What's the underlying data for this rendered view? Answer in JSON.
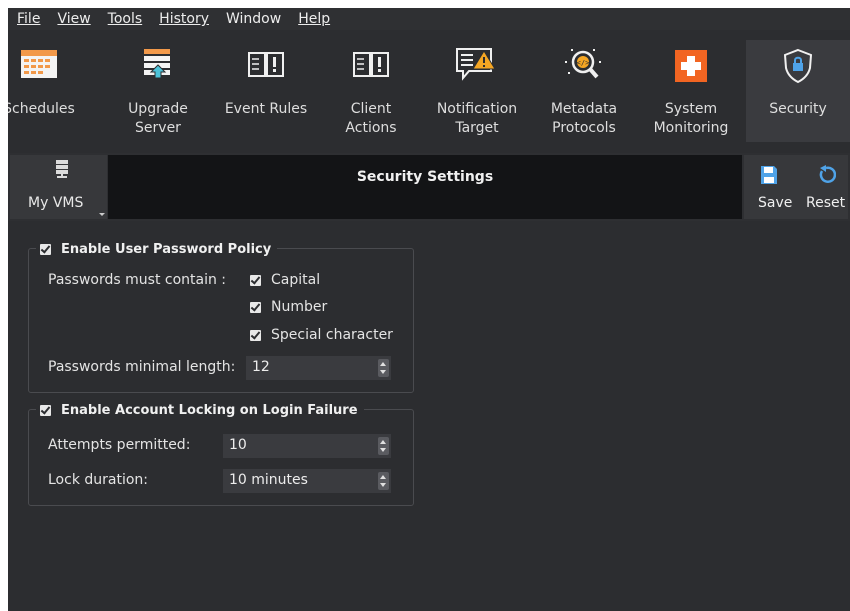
{
  "menubar": {
    "items": [
      {
        "label": "File"
      },
      {
        "label": "View"
      },
      {
        "label": "Tools"
      },
      {
        "label": "History"
      },
      {
        "label": "Window"
      },
      {
        "label": "Help"
      }
    ]
  },
  "toolbar": {
    "items": [
      {
        "line1": "Schedules",
        "line2": "",
        "icon": "calendar-icon"
      },
      {
        "line1": "Upgrade",
        "line2": "Server",
        "icon": "server-upgrade-icon"
      },
      {
        "line1": "Event Rules",
        "line2": "",
        "icon": "book-alert-icon"
      },
      {
        "line1": "Client",
        "line2": "Actions",
        "icon": "book-alert-icon"
      },
      {
        "line1": "Notification",
        "line2": "Target",
        "icon": "notification-warning-icon"
      },
      {
        "line1": "Metadata",
        "line2": "Protocols",
        "icon": "metadata-search-icon"
      },
      {
        "line1": "System",
        "line2": "Monitoring",
        "icon": "medical-cross-icon"
      },
      {
        "line1": "Security",
        "line2": "",
        "icon": "shield-lock-icon"
      }
    ],
    "active": "Security"
  },
  "header": {
    "vms_label": "My VMS",
    "title": "Security Settings",
    "save_label": "Save",
    "reset_label": "Reset"
  },
  "password_policy": {
    "title": "Enable User Password Policy",
    "enabled": true,
    "contain_label": "Passwords must contain :",
    "options": [
      {
        "label": "Capital",
        "checked": true
      },
      {
        "label": "Number",
        "checked": true
      },
      {
        "label": "Special character",
        "checked": true
      }
    ],
    "min_length_label": "Passwords minimal length:",
    "min_length_value": "12"
  },
  "account_locking": {
    "title": "Enable Account Locking on Login Failure",
    "enabled": true,
    "attempts_label": "Attempts permitted:",
    "attempts_value": "10",
    "duration_label": "Lock duration:",
    "duration_value": "10 minutes"
  },
  "colors": {
    "background": "#2c2d30",
    "title_bar": "#131416",
    "alert_orange": "#f5a623",
    "cross_orange": "#f26522",
    "calendar_orange": "#f2994a"
  }
}
